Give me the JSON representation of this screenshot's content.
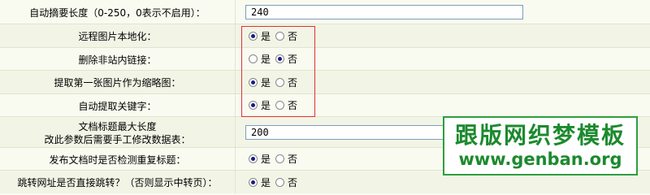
{
  "rows": {
    "summary_length": {
      "label": "自动摘要长度（0-250，0表示不启用）：",
      "value": "240"
    },
    "remote_images": {
      "label": "远程图片本地化：",
      "yes": "是",
      "no": "否",
      "selected": "yes"
    },
    "remove_links": {
      "label": "删除非站内链接：",
      "yes": "是",
      "no": "否",
      "selected": "no"
    },
    "first_image_thumb": {
      "label": "提取第一张图片作为缩略图：",
      "yes": "是",
      "no": "否",
      "selected": "yes"
    },
    "auto_keywords": {
      "label": "自动提取关键字：",
      "yes": "是",
      "no": "否",
      "selected": "yes"
    },
    "title_max_length": {
      "label_line1": "文档标题最大长度",
      "label_line2": "改此参数后需要手工修改数据表：",
      "value": "200"
    },
    "duplicate_title_check": {
      "label": "发布文档时是否检测重复标题：",
      "yes": "是",
      "no": "否",
      "selected": "yes"
    },
    "direct_redirect": {
      "label": "跳转网址是否直接跳转？（否则显示中转页）：",
      "yes": "是",
      "no": "否",
      "selected": "yes"
    }
  },
  "watermark": {
    "line1": "跟版网织梦模板",
    "line2": "www.genban.org"
  },
  "colors": {
    "highlight_border": "#dd3333",
    "watermark_green": "#1c8a2e"
  }
}
